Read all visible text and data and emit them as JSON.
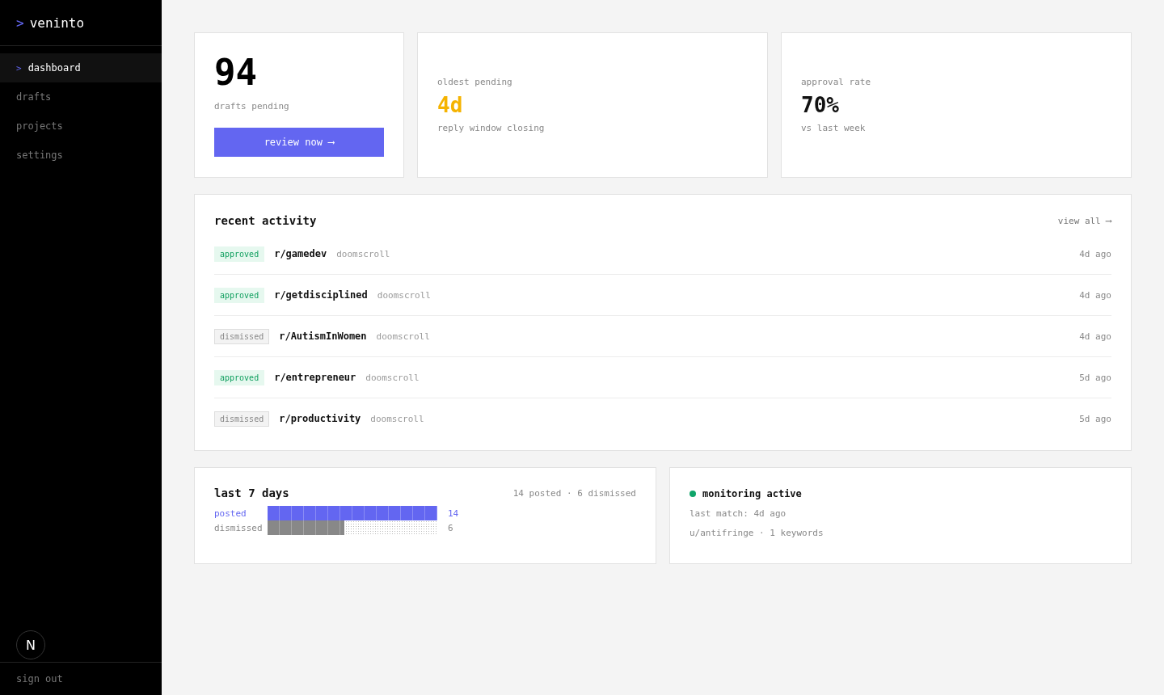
{
  "sidebar": {
    "brand": {
      "prompt": ">",
      "name": "veninto"
    },
    "items": [
      {
        "label": "dashboard",
        "selected": true,
        "marker": ">"
      },
      {
        "label": "drafts",
        "selected": false
      },
      {
        "label": "projects",
        "selected": false
      },
      {
        "label": "settings",
        "selected": false
      }
    ],
    "sign_out": "sign out",
    "dev_badge": "N"
  },
  "stats": [
    {
      "kind": "action",
      "value": "94",
      "label": "drafts pending",
      "button": "review now ⟶"
    },
    {
      "kind": "warning",
      "caption": "oldest pending",
      "value": "4d",
      "label": "reply window closing"
    },
    {
      "kind": "plain",
      "caption": "approval rate",
      "value": "70%",
      "label": "vs last week"
    }
  ],
  "activity": {
    "title": "recent activity",
    "link": "view all ⟶",
    "rows": [
      {
        "status": "approved",
        "subreddit": "r/gamedev",
        "project": "doomscroll",
        "time": "4d ago"
      },
      {
        "status": "approved",
        "subreddit": "r/getdisciplined",
        "project": "doomscroll",
        "time": "4d ago"
      },
      {
        "status": "dismissed",
        "subreddit": "r/AutismInWomen",
        "project": "doomscroll",
        "time": "4d ago"
      },
      {
        "status": "approved",
        "subreddit": "r/entrepreneur",
        "project": "doomscroll",
        "time": "5d ago"
      },
      {
        "status": "dismissed",
        "subreddit": "r/productivity",
        "project": "doomscroll",
        "time": "5d ago"
      }
    ]
  },
  "week": {
    "title": "last 7 days",
    "summary": "14 posted · 6 dismissed",
    "bars": [
      {
        "kind": "posted",
        "label": "posted",
        "count": "14",
        "level": 1
      },
      {
        "kind": "dismissed",
        "label": "dismissed",
        "count": "6",
        "level": 0.45
      }
    ]
  },
  "monitor": {
    "on": true,
    "title": "monitoring active",
    "lines": [
      "last match: 4d ago",
      "u/antifringe · 1 keywords"
    ]
  }
}
